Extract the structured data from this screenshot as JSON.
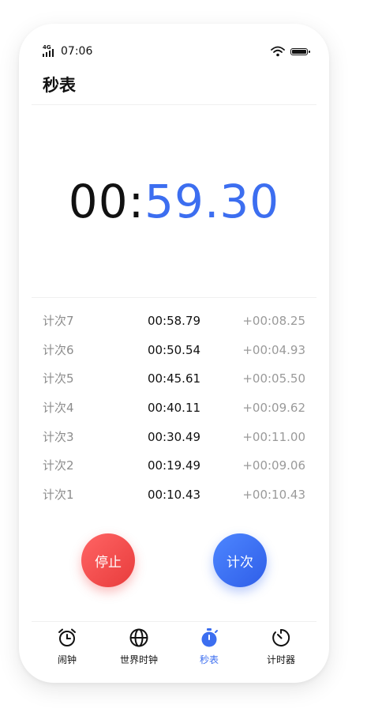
{
  "status_bar": {
    "network": "4G",
    "time": "07:06",
    "wifi_icon": "wifi-icon",
    "battery_icon": "battery-icon"
  },
  "header": {
    "title": "秒表"
  },
  "stopwatch": {
    "minutes": "00",
    "separator": ":",
    "seconds": "59.30",
    "minutes_color": "#111111",
    "seconds_color": "#3c6ef0"
  },
  "laps": [
    {
      "name": "计次7",
      "time": "00:58.79",
      "diff": "+00:08.25"
    },
    {
      "name": "计次6",
      "time": "00:50.54",
      "diff": "+00:04.93"
    },
    {
      "name": "计次5",
      "time": "00:45.61",
      "diff": "+00:05.50"
    },
    {
      "name": "计次4",
      "time": "00:40.11",
      "diff": "+00:09.62"
    },
    {
      "name": "计次3",
      "time": "00:30.49",
      "diff": "+00:11.00"
    },
    {
      "name": "计次2",
      "time": "00:19.49",
      "diff": "+00:09.06"
    },
    {
      "name": "计次1",
      "time": "00:10.43",
      "diff": "+00:10.43"
    }
  ],
  "controls": {
    "stop_label": "停止",
    "lap_label": "计次",
    "stop_color": "#f04646",
    "lap_color": "#3c6ef0"
  },
  "tabs": [
    {
      "label": "闹钟",
      "icon": "alarm-clock-icon",
      "active": false
    },
    {
      "label": "世界时钟",
      "icon": "globe-icon",
      "active": false
    },
    {
      "label": "秒表",
      "icon": "stopwatch-icon",
      "active": true
    },
    {
      "label": "计时器",
      "icon": "timer-icon",
      "active": false
    }
  ]
}
